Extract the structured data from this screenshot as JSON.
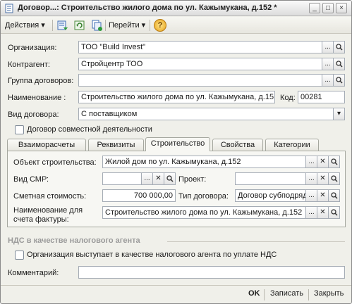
{
  "window": {
    "title": "Договор...: Строительство жилого дома по ул. Кажымукана, д.152 *",
    "buttons": {
      "minimize": "_",
      "maximize": "□",
      "close": "×"
    }
  },
  "toolbar": {
    "actions_label": "Действия",
    "goto_label": "Перейти",
    "dropdown_arrow": "▾",
    "help_glyph": "?"
  },
  "form": {
    "organization": {
      "label": "Организация:",
      "value": "ТОО \"Build Invest\""
    },
    "counterparty": {
      "label": "Контрагент:",
      "value": "Стройцентр ТОО"
    },
    "contract_group": {
      "label": "Группа договоров:",
      "value": ""
    },
    "name": {
      "label": "Наименование :",
      "value": "Строительство жилого дома по ул. Кажымукана, д.15"
    },
    "code": {
      "label": "Код:",
      "value": "00281"
    },
    "contract_kind": {
      "label": "Вид договора:",
      "value": "С поставщиком"
    },
    "joint_activity": {
      "label": "Договор совместной деятельности"
    }
  },
  "tabs": [
    "Взаиморасчеты",
    "Реквизиты",
    "Строительство",
    "Свойства",
    "Категории"
  ],
  "construction": {
    "object": {
      "label": "Объект строительства:",
      "value": "Жилой дом по ул. Кажымукана, д.152"
    },
    "smr_kind": {
      "label": "Вид СМР:",
      "value": ""
    },
    "project": {
      "label": "Проект:",
      "value": ""
    },
    "estimated_cost": {
      "label": "Сметная стоимость:",
      "value": "700 000,00"
    },
    "contract_type": {
      "label": "Тип договора:",
      "value": "Договор субподряд"
    },
    "invoice_name": {
      "label": "Наименование для\nсчета фактуры:",
      "label_line1": "Наименование для",
      "label_line2": "счета фактуры:",
      "value": "Строительство жилого дома по ул. Кажымукана, д.152"
    }
  },
  "vat": {
    "section_title": "НДС в качестве налогового агента",
    "agent_checkbox_label": "Организация выступает в качестве налогового агента по уплате НДС"
  },
  "comment": {
    "label": "Комментарий:",
    "value": ""
  },
  "bottom": {
    "ok": "OK",
    "save": "Записать",
    "close": "Закрыть"
  },
  "glyphs": {
    "ellipsis": "...",
    "clear": "✕",
    "search": "search-icon",
    "select_arrow": "▾"
  },
  "colors": {
    "accent": "#2f5fa8",
    "window_bg": "#f0f0ea",
    "field_border": "#a5acb5"
  }
}
